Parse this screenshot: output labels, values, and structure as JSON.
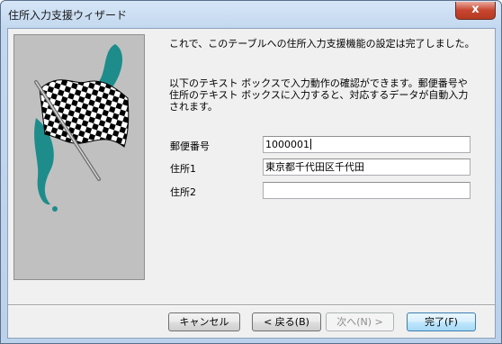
{
  "window": {
    "title": "住所入力支援ウィザード",
    "close_glyph": "x"
  },
  "content": {
    "message_line1": "これで、このテーブルへの住所入力支援機能の設定は完了しました。",
    "message_line2": "以下のテキスト ボックスで入力動作の確認ができます。郵便番号や住所のテキスト ボックスに入力すると、対応するデータが自動入力されます。"
  },
  "form": {
    "postal_code_label": "郵便番号",
    "postal_code_value": "1000001",
    "address1_label": "住所1",
    "address1_value": "東京都千代田区千代田",
    "address2_label": "住所2",
    "address2_value": ""
  },
  "buttons": {
    "cancel": "キャンセル",
    "back": "< 戻る(B)",
    "next": "次へ(N) >",
    "finish": "完了(F)"
  },
  "colors": {
    "teal_accent": "#1f8c8c",
    "panel_gray": "#c0c0c0"
  }
}
